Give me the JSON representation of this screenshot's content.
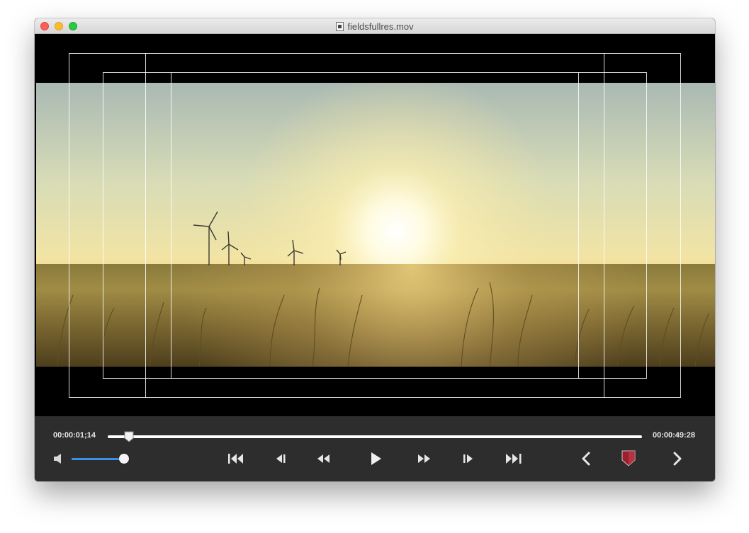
{
  "window": {
    "title": "fieldsfullres.mov"
  },
  "icons": {
    "close": "close-traffic-light",
    "minimize": "minimize-traffic-light",
    "zoom": "zoom-traffic-light",
    "document": "movie-document-icon",
    "volume": "speaker-icon",
    "skip_start": "skip-to-start-icon",
    "step_back": "step-back-frame-icon",
    "rewind": "rewind-icon",
    "play": "play-icon",
    "fast_forward": "fast-forward-icon",
    "step_forward": "step-forward-frame-icon",
    "skip_end": "skip-to-end-icon",
    "prev": "chevron-left-icon",
    "marker": "shield-marker-icon",
    "next": "chevron-right-icon"
  },
  "video": {
    "content": "sunset wheat field with wind turbines"
  },
  "playback": {
    "current_time": "00:00:01;14",
    "total_time": "00:00:49:28",
    "position_fraction": 0.04
  },
  "volume": {
    "level_fraction": 0.98
  },
  "colors": {
    "accent": "#3b8fe8",
    "controls_bg": "#2d2d2d",
    "marker": "#9b1f2c"
  }
}
